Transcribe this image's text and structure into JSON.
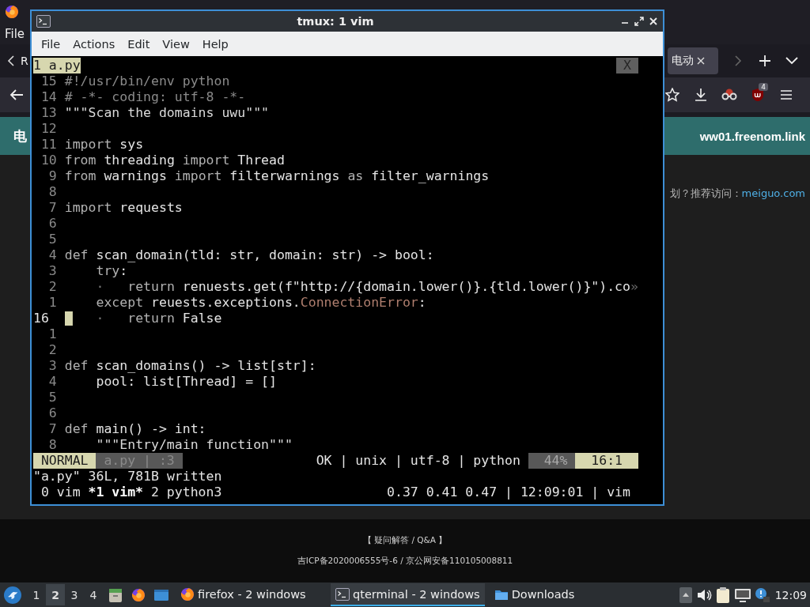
{
  "browser": {
    "menu": [
      "File"
    ],
    "tabs": [
      {
        "label": "R",
        "selected": false
      },
      {
        "label": "电动",
        "selected": true
      }
    ],
    "extension_badge": "4",
    "header": {
      "site_initial": "电",
      "domain": "ww01.freenom.link"
    },
    "notice": {
      "text": "划？推荐访问：",
      "link": "meiguo.com"
    },
    "footer": [
      "【 疑问解答 / Q&A 】",
      "吉ICP备2020006555号-6 / 京公网安备110105008811"
    ]
  },
  "terminal": {
    "title": "tmux: 1 vim",
    "menu": [
      "File",
      "Actions",
      "Edit",
      "View",
      "Help"
    ],
    "vim": {
      "buffers": [
        {
          "label": "1 a.py",
          "selected": true
        }
      ],
      "close_label": "X",
      "lines": [
        {
          "number": "15",
          "current": false,
          "segments": [
            {
              "kind": "comment",
              "text": "#!/usr/bin/env python"
            }
          ]
        },
        {
          "number": "14",
          "current": false,
          "segments": [
            {
              "kind": "comment",
              "text": "# -*- coding: utf-8 -*-"
            }
          ]
        },
        {
          "number": "13",
          "current": false,
          "segments": [
            {
              "kind": "string",
              "text": "\"\"\"Scan the domains uwu\"\"\""
            }
          ]
        },
        {
          "number": "12",
          "current": false
        },
        {
          "number": "11",
          "current": false,
          "segments": [
            {
              "kind": "keyword",
              "text": "import"
            },
            {
              "kind": "plain",
              "text": " sys"
            }
          ]
        },
        {
          "number": "10",
          "current": false,
          "segments": [
            {
              "kind": "keyword",
              "text": "from"
            },
            {
              "kind": "plain",
              "text": " threading "
            },
            {
              "kind": "keyword",
              "text": "import"
            },
            {
              "kind": "plain",
              "text": " Thread"
            }
          ]
        },
        {
          "number": "9",
          "current": false,
          "segments": [
            {
              "kind": "keyword",
              "text": "from"
            },
            {
              "kind": "plain",
              "text": " warnings "
            },
            {
              "kind": "keyword",
              "text": "import"
            },
            {
              "kind": "plain",
              "text": " filterwarnings "
            },
            {
              "kind": "keyword",
              "text": "as"
            },
            {
              "kind": "plain",
              "text": " filter_warnings"
            }
          ]
        },
        {
          "number": "8",
          "current": false
        },
        {
          "number": "7",
          "current": false,
          "segments": [
            {
              "kind": "keyword",
              "text": "import"
            },
            {
              "kind": "plain",
              "text": " requests"
            }
          ]
        },
        {
          "number": "6",
          "current": false
        },
        {
          "number": "5",
          "current": false
        },
        {
          "number": "4",
          "current": false,
          "segments": [
            {
              "kind": "keyword",
              "text": "def"
            },
            {
              "kind": "plain",
              "text": " scan_domain(tld: str, domain: str) -> bool:"
            }
          ]
        },
        {
          "number": "3",
          "current": false,
          "segments": [
            {
              "kind": "keyword",
              "text": "    try"
            },
            {
              "kind": "plain",
              "text": ":"
            }
          ]
        },
        {
          "number": "2",
          "current": false,
          "segments": [
            {
              "kind": "whitespace",
              "text": "    ·   "
            },
            {
              "kind": "keyword",
              "text": "return"
            },
            {
              "kind": "plain",
              "text": " renuests.get(f\"http://{domain.lower()}.{tld.lower()}\").co"
            },
            {
              "kind": "overflow",
              "text": "»"
            }
          ]
        },
        {
          "number": "1",
          "current": false,
          "segments": [
            {
              "kind": "keyword",
              "text": "    except"
            },
            {
              "kind": "plain",
              "text": " reuests.exceptions."
            },
            {
              "kind": "type",
              "text": "ConnectionError"
            },
            {
              "kind": "plain",
              "text": ":"
            }
          ]
        },
        {
          "number": "16",
          "current": true,
          "segments": [
            {
              "kind": "whitespace",
              "text": "    ·   "
            },
            {
              "kind": "keyword",
              "text": "return"
            },
            {
              "kind": "plain",
              "text": " False"
            }
          ]
        },
        {
          "number": "1",
          "current": false
        },
        {
          "number": "2",
          "current": false
        },
        {
          "number": "3",
          "current": false,
          "segments": [
            {
              "kind": "keyword",
              "text": "def"
            },
            {
              "kind": "plain",
              "text": " scan_domains() -> list[str]:"
            }
          ]
        },
        {
          "number": "4",
          "current": false,
          "segments": [
            {
              "kind": "plain",
              "text": "    pool: list[Thread] = []"
            }
          ]
        },
        {
          "number": "5",
          "current": false
        },
        {
          "number": "6",
          "current": false
        },
        {
          "number": "7",
          "current": false,
          "segments": [
            {
              "kind": "keyword",
              "text": "def"
            },
            {
              "kind": "plain",
              "text": " main() -> int:"
            }
          ]
        },
        {
          "number": "8",
          "current": false,
          "segments": [
            {
              "kind": "string",
              "text": "    \"\"\"Entry/main function\"\"\""
            }
          ]
        }
      ],
      "status": {
        "mode": "NORMAL",
        "file": "a.py | :3",
        "info": "OK | unix | utf-8 | python",
        "percent": "44%",
        "position": "16:1"
      },
      "message": "\"a.py\" 36L, 781B written"
    },
    "tmux": {
      "windows": [
        {
          "label": "0 vim",
          "selected": false
        },
        {
          "label": "*1 vim*",
          "selected": true
        },
        {
          "label": "2 python3",
          "selected": false
        }
      ],
      "status_right": "0.37 0.41 0.47 | 12:09:01 | vim"
    }
  },
  "taskbar": {
    "workspaces": [
      {
        "label": "1",
        "selected": false
      },
      {
        "label": "2",
        "selected": true
      },
      {
        "label": "3",
        "selected": false
      },
      {
        "label": "4",
        "selected": false
      }
    ],
    "tasks": [
      {
        "kind": "firefox",
        "label": "firefox - 2 windows",
        "selected": false
      },
      {
        "kind": "terminal",
        "label": "qterminal - 2 windows",
        "selected": true
      },
      {
        "kind": "folder",
        "label": "Downloads",
        "selected": false
      }
    ],
    "clock": "12:09"
  }
}
